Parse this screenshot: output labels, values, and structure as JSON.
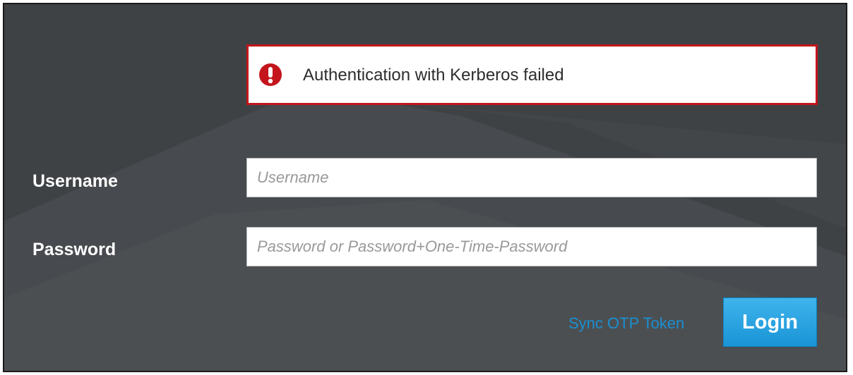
{
  "alert": {
    "icon": "exclamation-circle-icon",
    "message": "Authentication with Kerberos failed",
    "color": "#c4151c"
  },
  "form": {
    "username_label": "Username",
    "username_placeholder": "Username",
    "username_value": "",
    "password_label": "Password",
    "password_placeholder": "Password or Password+One-Time-Password",
    "password_value": ""
  },
  "actions": {
    "sync_link": "Sync OTP Token",
    "login_button": "Login"
  },
  "colors": {
    "background": "#3f4245",
    "accent": "#1b8fd0",
    "error": "#c4151c"
  }
}
